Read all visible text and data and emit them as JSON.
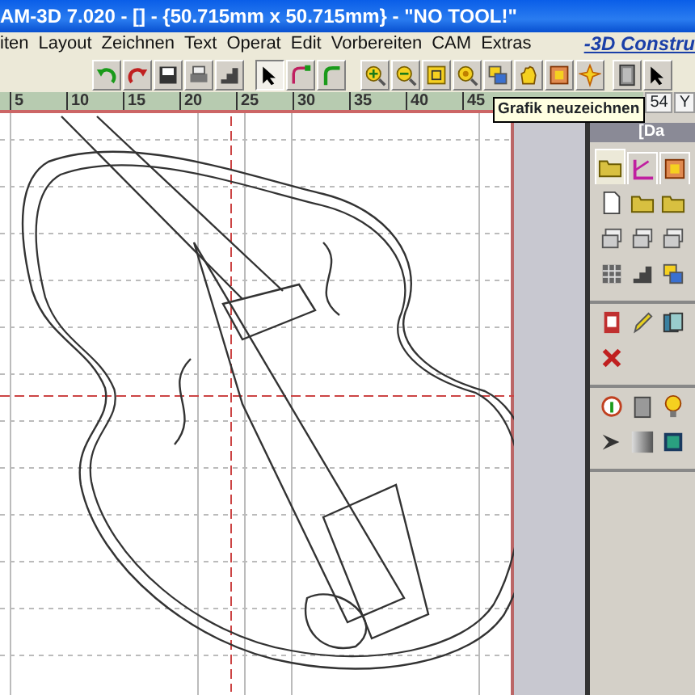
{
  "window": {
    "title": "AM-3D 7.020 - [] - {50.715mm x 50.715mm} - \"NO TOOL!\""
  },
  "menu": {
    "items": [
      "iten",
      "Layout",
      "Zeichnen",
      "Text",
      "Operat",
      "Edit",
      "Vorbereiten",
      "CAM",
      "Extras"
    ],
    "brand": "-3D Constru"
  },
  "toolbar": {
    "groups": [
      [
        {
          "kind": "undo",
          "selected": false
        },
        {
          "kind": "redo",
          "selected": false
        },
        {
          "kind": "save",
          "selected": false
        },
        {
          "kind": "print",
          "selected": false
        },
        {
          "kind": "stairs",
          "selected": false
        }
      ],
      [
        {
          "kind": "cursor",
          "selected": true
        },
        {
          "kind": "node",
          "selected": false
        },
        {
          "kind": "corner",
          "selected": false
        }
      ],
      [
        {
          "kind": "zoomin",
          "selected": false
        },
        {
          "kind": "zoomout",
          "selected": false
        },
        {
          "kind": "zoomfit",
          "selected": false
        },
        {
          "kind": "redraw",
          "selected": false
        },
        {
          "kind": "layers",
          "selected": false
        },
        {
          "kind": "hand",
          "selected": false
        },
        {
          "kind": "frame",
          "selected": false
        },
        {
          "kind": "star",
          "selected": false
        }
      ],
      [
        {
          "kind": "door",
          "selected": false
        },
        {
          "kind": "cursor",
          "selected": false
        }
      ]
    ]
  },
  "tooltip": "Grafik neuzeichnen",
  "ruler": {
    "labels": [
      "5",
      "10",
      "15",
      "20",
      "25",
      "30",
      "35",
      "40",
      "45"
    ],
    "fields": [
      "54",
      "Y"
    ]
  },
  "side_panel": {
    "header": "[Da",
    "tabs": [
      {
        "kind": "folder",
        "selected": true
      },
      {
        "kind": "angle",
        "selected": false
      },
      {
        "kind": "frame",
        "selected": false
      }
    ],
    "groups": [
      {
        "rows": [
          [
            {
              "kind": "document"
            },
            {
              "kind": "folder"
            },
            {
              "kind": "folder"
            }
          ],
          [
            {
              "kind": "stack"
            },
            {
              "kind": "stack"
            },
            {
              "kind": "stack"
            }
          ],
          [
            {
              "kind": "grid"
            },
            {
              "kind": "stairs"
            },
            {
              "kind": "layers"
            }
          ]
        ]
      },
      {
        "rows": [
          [
            {
              "kind": "reddoc"
            },
            {
              "kind": "pencil"
            },
            {
              "kind": "cards"
            }
          ],
          [
            {
              "kind": "cross"
            }
          ]
        ]
      },
      {
        "rows": [
          [
            {
              "kind": "info"
            },
            {
              "kind": "gray"
            },
            {
              "kind": "bulb"
            }
          ],
          [
            {
              "kind": "chevron"
            },
            {
              "kind": "gradient"
            },
            {
              "kind": "picture"
            }
          ]
        ]
      }
    ]
  }
}
